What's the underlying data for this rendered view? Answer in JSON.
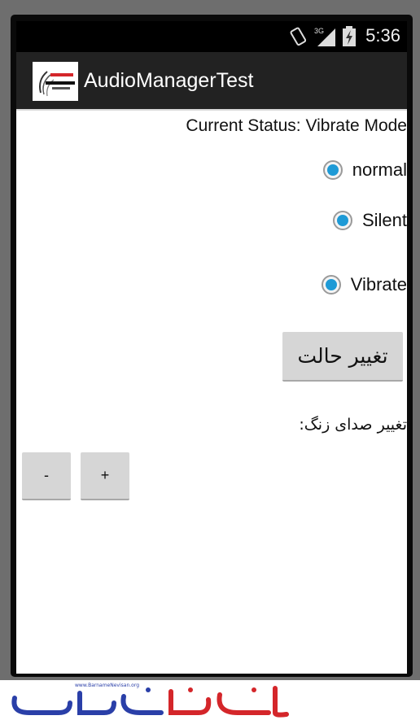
{
  "status_bar": {
    "time": "5:36",
    "network": "3G"
  },
  "action_bar": {
    "title": "AudioManagerTest",
    "logo_icon": "app-logo-icon"
  },
  "content": {
    "current_status": "Current Status: Vibrate Mode",
    "modes": [
      {
        "label": "normal",
        "selected": true
      },
      {
        "label": "Silent",
        "selected": true
      },
      {
        "label": "Vibrate",
        "selected": true
      }
    ],
    "change_mode_button": "تغییر حالت",
    "ringer_label": "تغییر صدای زنگ:",
    "volume_down": "-",
    "volume_up": "+"
  },
  "branding": {
    "url_text": "www.BarnameNevisan.org"
  },
  "colors": {
    "accent": "#1e9ad6",
    "action_bar": "#222222",
    "brand_blue": "#2a3fa8",
    "brand_red": "#d4262a"
  }
}
